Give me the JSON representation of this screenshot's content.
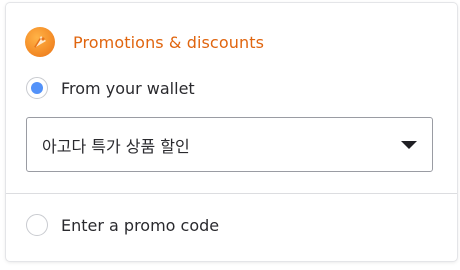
{
  "header": {
    "icon": "promotion-tag-icon",
    "title": "Promotions & discounts",
    "accent_color": "#e0650f"
  },
  "wallet_option": {
    "label": "From your wallet",
    "selected": true
  },
  "wallet_select": {
    "selected_value": "아고다 특가 상품 할인"
  },
  "promo_option": {
    "label": "Enter a promo code",
    "selected": false
  },
  "colors": {
    "radio_selected": "#5392f9",
    "icon_orange": "#f5902a"
  }
}
